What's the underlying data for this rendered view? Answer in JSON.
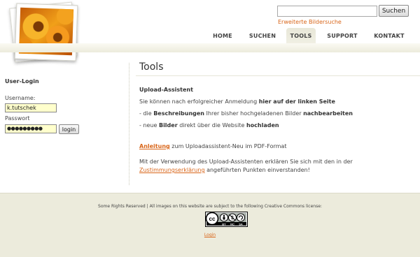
{
  "search": {
    "input_value": "",
    "button_label": "Suchen",
    "advanced_link": "Erweiterte Bildersuche"
  },
  "nav": {
    "items": [
      {
        "label": "HOME"
      },
      {
        "label": "SUCHEN"
      },
      {
        "label": "TOOLS"
      },
      {
        "label": "SUPPORT"
      },
      {
        "label": "KONTAKT"
      }
    ],
    "active": "TOOLS"
  },
  "sidebar": {
    "heading": "User-Login",
    "username_label": "Username:",
    "username_value": "k.tutschek",
    "password_label": "Passwort",
    "password_value": "●●●●●●●●●",
    "login_button": "login"
  },
  "main": {
    "title": "Tools",
    "section_heading": "Upload-Assistent",
    "line1_pre": "Sie können nach erfolgreicher Anmeldung ",
    "line1_bold": "hier auf der linken Seite",
    "line2_pre": "- die ",
    "line2_bold1": "Beschreibungen",
    "line2_mid": " Ihrer bisher hochgeladenen Bilder ",
    "line2_bold2": "nachbearbeiten",
    "line3_pre": "- neue ",
    "line3_bold1": "Bilder",
    "line3_mid": " direkt über die Website ",
    "line3_bold2": "hochladen",
    "guide_link": "Anleitung",
    "guide_rest": " zum Uploadassistent-Neu im PDF-Format",
    "consent_line1": "Mit der Verwendung des Upload-Assistenten erklären Sie sich mit den in der",
    "consent_link": "Zustimmungserklärung",
    "consent_rest": " angeführten Punkten einverstanden!"
  },
  "footer": {
    "license_text": "Some Rights Reserved | All images on this website are subject to the following Creative Commons license:",
    "cc_labels": [
      "BY",
      "NC",
      "SA"
    ],
    "login_link": "Login"
  },
  "colors": {
    "accent": "#d9661a",
    "nav_band": "#ecebdc",
    "field_bg": "#ffffcc"
  }
}
